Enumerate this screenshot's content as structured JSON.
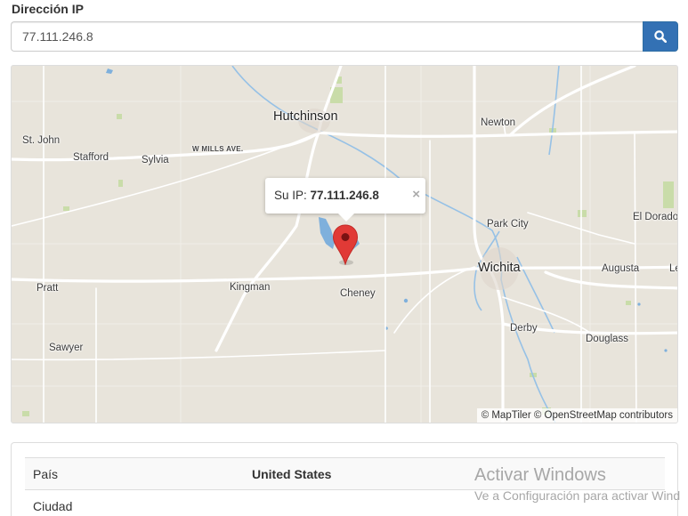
{
  "form": {
    "label": "Dirección IP",
    "ip_value": "77.111.246.8",
    "search_icon": "search-icon"
  },
  "map": {
    "places": {
      "hutchinson": "Hutchinson",
      "newton": "Newton",
      "st_john": "St. John",
      "stafford": "Stafford",
      "sylvia": "Sylvia",
      "w_mills_ave": "W MILLS AVE.",
      "park_city": "Park City",
      "el_dorado": "El Dorado",
      "wichita": "Wichita",
      "augusta": "Augusta",
      "le": "Le",
      "pratt": "Pratt",
      "kingman": "Kingman",
      "cheney": "Cheney",
      "derby": "Derby",
      "douglass": "Douglass",
      "sawyer": "Sawyer"
    },
    "popup": {
      "prefix": "Su IP: ",
      "ip": "77.111.246.8",
      "close": "×"
    },
    "marker_icon": "map-pin-icon",
    "attribution": "© MapTiler © OpenStreetMap contributors"
  },
  "info": {
    "rows": [
      {
        "key": "País",
        "value": "United States"
      },
      {
        "key": "Ciudad",
        "value": ""
      }
    ]
  },
  "watermark": {
    "line1": "Activar Windows",
    "line2": "Ve a Configuración para activar Wind"
  }
}
